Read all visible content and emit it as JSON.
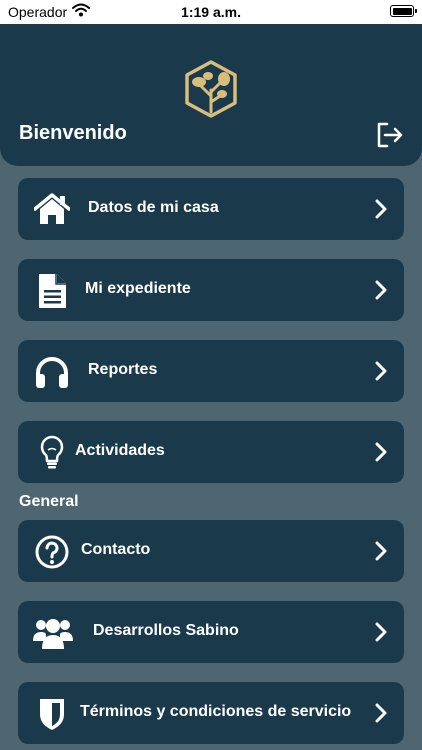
{
  "status_bar": {
    "carrier": "Operador",
    "time": "1:19 a.m."
  },
  "header": {
    "welcome": "Bienvenido"
  },
  "menu": [
    {
      "label": "Datos de mi casa",
      "icon": "house-icon"
    },
    {
      "label": "Mi expediente",
      "icon": "document-icon"
    },
    {
      "label": "Reportes",
      "icon": "headphones-icon"
    },
    {
      "label": "Actividades",
      "icon": "lightbulb-icon"
    }
  ],
  "general": {
    "title": "General",
    "items": [
      {
        "label": "Contacto",
        "icon": "question-circle-icon"
      },
      {
        "label": "Desarrollos Sabino",
        "icon": "users-icon"
      },
      {
        "label": "Términos y condiciones de servicio",
        "icon": "shield-icon"
      }
    ]
  },
  "colors": {
    "background": "#4d6672",
    "card": "#1a3a4c",
    "logo_gold": "#d9bd7d",
    "text": "#ffffff"
  }
}
